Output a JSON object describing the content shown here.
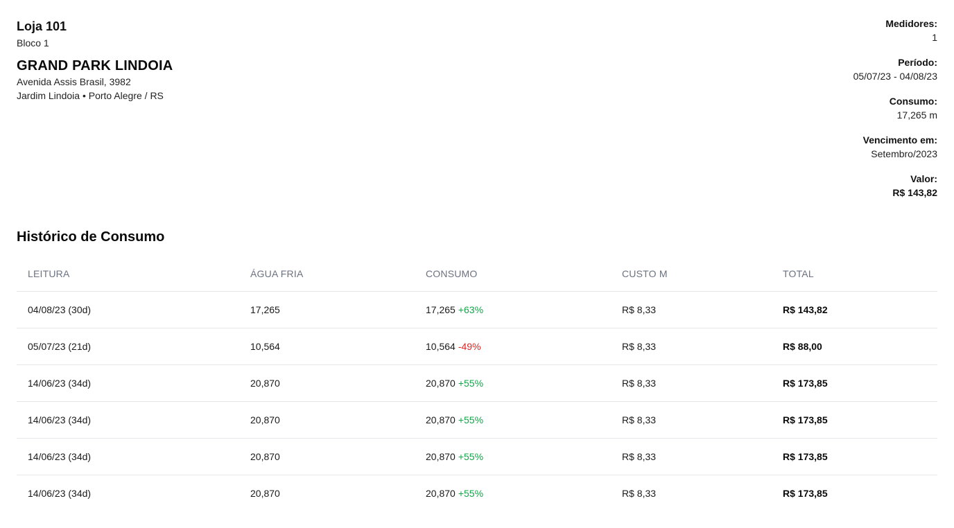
{
  "header": {
    "store_title": "Loja 101",
    "store_block": "Bloco 1",
    "condo_name": "GRAND PARK LINDOIA",
    "address_line1": "Avenida Assis Brasil, 3982",
    "address_line2": "Jardim Lindoia • Porto Alegre / RS"
  },
  "summary": [
    {
      "label": "Medidores:",
      "value": "1"
    },
    {
      "label": "Período:",
      "value": "05/07/23 - 04/08/23"
    },
    {
      "label": "Consumo:",
      "value": "17,265 m"
    },
    {
      "label": "Vencimento em:",
      "value": "Setembro/2023"
    },
    {
      "label": "Valor:",
      "value": "R$ 143,82"
    }
  ],
  "history": {
    "title": "Histórico de Consumo",
    "columns": [
      "LEITURA",
      "ÁGUA FRIA",
      "CONSUMO",
      "CUSTO M",
      "TOTAL"
    ],
    "rows": [
      {
        "leitura": "04/08/23 (30d)",
        "agua_fria": "17,265",
        "consumo": "17,265",
        "delta": "+63%",
        "delta_dir": "up",
        "custo": "R$ 8,33",
        "total": "R$ 143,82"
      },
      {
        "leitura": "05/07/23 (21d)",
        "agua_fria": "10,564",
        "consumo": "10,564",
        "delta": "-49%",
        "delta_dir": "down",
        "custo": "R$ 8,33",
        "total": "R$ 88,00"
      },
      {
        "leitura": "14/06/23 (34d)",
        "agua_fria": "20,870",
        "consumo": "20,870",
        "delta": "+55%",
        "delta_dir": "up",
        "custo": "R$ 8,33",
        "total": "R$ 173,85"
      },
      {
        "leitura": "14/06/23 (34d)",
        "agua_fria": "20,870",
        "consumo": "20,870",
        "delta": "+55%",
        "delta_dir": "up",
        "custo": "R$ 8,33",
        "total": "R$ 173,85"
      },
      {
        "leitura": "14/06/23 (34d)",
        "agua_fria": "20,870",
        "consumo": "20,870",
        "delta": "+55%",
        "delta_dir": "up",
        "custo": "R$ 8,33",
        "total": "R$ 173,85"
      },
      {
        "leitura": "14/06/23 (34d)",
        "agua_fria": "20,870",
        "consumo": "20,870",
        "delta": "+55%",
        "delta_dir": "up",
        "custo": "R$ 8,33",
        "total": "R$ 173,85"
      }
    ]
  },
  "colors": {
    "positive": "#16a34a",
    "negative": "#dc2626",
    "header_text": "#6b7280",
    "divider": "#e5e7eb"
  }
}
